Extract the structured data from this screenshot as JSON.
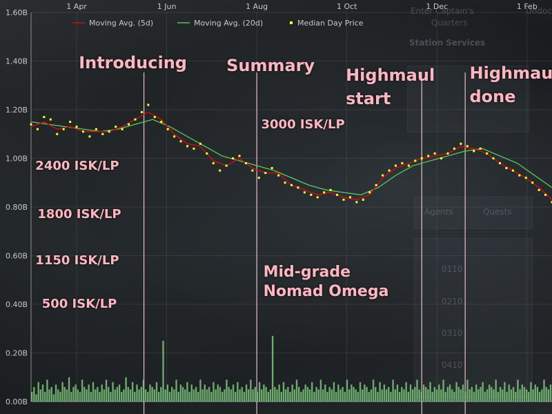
{
  "chart_data": {
    "type": "line",
    "title": "",
    "xlabel": "",
    "ylabel": "",
    "x_ticks": [
      "1 Apr",
      "1 Jun",
      "1 Aug",
      "1 Oct",
      "1 Dec",
      "1 Feb"
    ],
    "y_ticks": [
      "0.00B",
      "0.20B",
      "0.40B",
      "0.60B",
      "0.80B",
      "1.00B",
      "1.20B",
      "1.40B",
      "1.60B"
    ],
    "ylim": [
      0,
      1.6
    ],
    "grid": true,
    "legend_position": "top",
    "legend": [
      "Moving Avg.  (5d)",
      "Moving Avg.  (20d)",
      "Median Day Price"
    ],
    "colors": {
      "ma5": "#cc1111",
      "ma20": "#59c159",
      "median": "#ffff33",
      "volume": "#7cc47c",
      "annotation": "#ffb6c1",
      "vline": "#ffd1d9"
    },
    "series": [
      {
        "name": "Median Day Price",
        "points": [
          [
            0,
            1.14
          ],
          [
            3,
            1.12
          ],
          [
            6,
            1.17
          ],
          [
            9,
            1.16
          ],
          [
            12,
            1.1
          ],
          [
            15,
            1.12
          ],
          [
            18,
            1.15
          ],
          [
            21,
            1.13
          ],
          [
            24,
            1.11
          ],
          [
            27,
            1.09
          ],
          [
            30,
            1.12
          ],
          [
            33,
            1.1
          ],
          [
            36,
            1.11
          ],
          [
            39,
            1.13
          ],
          [
            42,
            1.12
          ],
          [
            45,
            1.14
          ],
          [
            48,
            1.16
          ],
          [
            51,
            1.19
          ],
          [
            54,
            1.22
          ],
          [
            57,
            1.17
          ],
          [
            60,
            1.15
          ],
          [
            63,
            1.12
          ],
          [
            66,
            1.09
          ],
          [
            69,
            1.07
          ],
          [
            72,
            1.05
          ],
          [
            75,
            1.04
          ],
          [
            78,
            1.06
          ],
          [
            81,
            1.02
          ],
          [
            84,
            0.98
          ],
          [
            87,
            0.95
          ],
          [
            90,
            0.97
          ],
          [
            93,
            1.0
          ],
          [
            96,
            1.01
          ],
          [
            99,
            0.98
          ],
          [
            102,
            0.95
          ],
          [
            105,
            0.92
          ],
          [
            108,
            0.94
          ],
          [
            111,
            0.96
          ],
          [
            114,
            0.93
          ],
          [
            117,
            0.9
          ],
          [
            120,
            0.89
          ],
          [
            123,
            0.88
          ],
          [
            126,
            0.86
          ],
          [
            129,
            0.85
          ],
          [
            132,
            0.84
          ],
          [
            135,
            0.86
          ],
          [
            138,
            0.87
          ],
          [
            141,
            0.85
          ],
          [
            144,
            0.83
          ],
          [
            147,
            0.84
          ],
          [
            150,
            0.82
          ],
          [
            153,
            0.83
          ],
          [
            156,
            0.86
          ],
          [
            159,
            0.89
          ],
          [
            162,
            0.93
          ],
          [
            165,
            0.95
          ],
          [
            168,
            0.97
          ],
          [
            171,
            0.98
          ],
          [
            174,
            0.97
          ],
          [
            177,
            0.99
          ],
          [
            180,
            1.0
          ],
          [
            183,
            1.01
          ],
          [
            186,
            1.02
          ],
          [
            189,
            1.0
          ],
          [
            192,
            1.02
          ],
          [
            195,
            1.04
          ],
          [
            198,
            1.06
          ],
          [
            201,
            1.05
          ],
          [
            204,
            1.03
          ],
          [
            207,
            1.04
          ],
          [
            210,
            1.02
          ],
          [
            213,
            1.0
          ],
          [
            216,
            0.98
          ],
          [
            219,
            0.96
          ],
          [
            222,
            0.95
          ],
          [
            225,
            0.93
          ],
          [
            228,
            0.92
          ],
          [
            231,
            0.9
          ],
          [
            234,
            0.87
          ],
          [
            237,
            0.85
          ],
          [
            240,
            0.82
          ]
        ]
      },
      {
        "name": "Moving Avg.  (5d)",
        "points": [
          [
            0,
            1.13
          ],
          [
            6,
            1.15
          ],
          [
            12,
            1.12
          ],
          [
            18,
            1.13
          ],
          [
            24,
            1.11
          ],
          [
            30,
            1.11
          ],
          [
            36,
            1.11
          ],
          [
            42,
            1.13
          ],
          [
            48,
            1.16
          ],
          [
            54,
            1.19
          ],
          [
            60,
            1.16
          ],
          [
            66,
            1.1
          ],
          [
            72,
            1.06
          ],
          [
            78,
            1.05
          ],
          [
            84,
            0.99
          ],
          [
            90,
            0.97
          ],
          [
            96,
            1.0
          ],
          [
            102,
            0.96
          ],
          [
            108,
            0.94
          ],
          [
            114,
            0.94
          ],
          [
            120,
            0.89
          ],
          [
            126,
            0.87
          ],
          [
            132,
            0.85
          ],
          [
            138,
            0.86
          ],
          [
            144,
            0.84
          ],
          [
            150,
            0.83
          ],
          [
            156,
            0.85
          ],
          [
            162,
            0.92
          ],
          [
            168,
            0.96
          ],
          [
            174,
            0.98
          ],
          [
            180,
            1.0
          ],
          [
            186,
            1.01
          ],
          [
            192,
            1.02
          ],
          [
            198,
            1.05
          ],
          [
            204,
            1.04
          ],
          [
            210,
            1.02
          ],
          [
            216,
            0.98
          ],
          [
            222,
            0.95
          ],
          [
            228,
            0.92
          ],
          [
            234,
            0.88
          ],
          [
            240,
            0.83
          ]
        ]
      },
      {
        "name": "Moving Avg.  (20d)",
        "points": [
          [
            0,
            1.15
          ],
          [
            8,
            1.14
          ],
          [
            16,
            1.13
          ],
          [
            24,
            1.12
          ],
          [
            32,
            1.11
          ],
          [
            40,
            1.12
          ],
          [
            48,
            1.14
          ],
          [
            56,
            1.16
          ],
          [
            64,
            1.13
          ],
          [
            72,
            1.09
          ],
          [
            80,
            1.05
          ],
          [
            88,
            1.01
          ],
          [
            96,
            0.99
          ],
          [
            104,
            0.97
          ],
          [
            112,
            0.95
          ],
          [
            120,
            0.92
          ],
          [
            128,
            0.89
          ],
          [
            136,
            0.87
          ],
          [
            144,
            0.86
          ],
          [
            152,
            0.85
          ],
          [
            160,
            0.88
          ],
          [
            168,
            0.93
          ],
          [
            176,
            0.97
          ],
          [
            184,
            0.99
          ],
          [
            192,
            1.01
          ],
          [
            200,
            1.03
          ],
          [
            208,
            1.04
          ],
          [
            216,
            1.01
          ],
          [
            224,
            0.98
          ],
          [
            232,
            0.93
          ],
          [
            240,
            0.88
          ]
        ]
      },
      {
        "name": "Volume",
        "values": [
          0.04,
          0.06,
          0.03,
          0.08,
          0.05,
          0.07,
          0.04,
          0.09,
          0.05,
          0.06,
          0.03,
          0.07,
          0.05,
          0.04,
          0.08,
          0.06,
          0.05,
          0.1,
          0.04,
          0.06,
          0.07,
          0.05,
          0.04,
          0.09,
          0.06,
          0.05,
          0.07,
          0.04,
          0.08,
          0.05,
          0.06,
          0.04,
          0.07,
          0.05,
          0.09,
          0.06,
          0.04,
          0.08,
          0.05,
          0.06,
          0.07,
          0.04,
          0.05,
          0.1,
          0.06,
          0.05,
          0.08,
          0.04,
          0.07,
          0.05,
          0.06,
          0.09,
          0.05,
          0.04,
          0.07,
          0.06,
          0.05,
          0.08,
          0.04,
          0.06,
          0.25,
          0.05,
          0.07,
          0.04,
          0.06,
          0.05,
          0.09,
          0.04,
          0.07,
          0.06,
          0.05,
          0.08,
          0.04,
          0.07,
          0.05,
          0.06,
          0.04,
          0.09,
          0.05,
          0.07,
          0.05,
          0.06,
          0.04,
          0.08,
          0.05,
          0.07,
          0.06,
          0.04,
          0.05,
          0.09,
          0.06,
          0.05,
          0.07,
          0.04,
          0.08,
          0.05,
          0.06,
          0.04,
          0.07,
          0.05,
          0.09,
          0.05,
          0.06,
          0.04,
          0.08,
          0.05,
          0.07,
          0.06,
          0.04,
          0.05,
          0.27,
          0.06,
          0.05,
          0.07,
          0.04,
          0.08,
          0.05,
          0.06,
          0.04,
          0.07,
          0.05,
          0.09,
          0.06,
          0.04,
          0.05,
          0.07,
          0.06,
          0.05,
          0.08,
          0.04,
          0.06,
          0.05,
          0.09,
          0.05,
          0.07,
          0.04,
          0.06,
          0.05,
          0.08,
          0.04,
          0.07,
          0.05,
          0.06,
          0.04,
          0.09,
          0.05,
          0.07,
          0.06,
          0.05,
          0.04,
          0.08,
          0.05,
          0.07,
          0.06,
          0.04,
          0.05,
          0.09,
          0.06,
          0.04,
          0.08,
          0.05,
          0.07,
          0.05,
          0.06,
          0.04,
          0.09,
          0.05,
          0.07,
          0.04,
          0.06,
          0.05,
          0.08,
          0.04,
          0.07,
          0.05,
          0.06,
          0.09,
          0.05,
          0.04,
          0.07,
          0.06,
          0.05,
          0.08,
          0.04,
          0.06,
          0.05,
          0.07,
          0.05,
          0.09,
          0.04,
          0.06,
          0.07,
          0.05,
          0.04,
          0.08,
          0.06,
          0.05,
          0.07,
          0.04,
          0.09,
          0.05,
          0.06,
          0.04,
          0.07,
          0.05,
          0.06,
          0.08,
          0.04,
          0.05,
          0.07,
          0.06,
          0.05,
          0.09,
          0.04,
          0.06,
          0.05,
          0.08,
          0.04,
          0.07,
          0.05,
          0.06,
          0.04,
          0.09,
          0.05,
          0.07,
          0.06,
          0.05,
          0.04,
          0.08,
          0.05,
          0.07,
          0.06,
          0.04,
          0.05,
          0.09,
          0.06,
          0.05,
          0.07
        ]
      }
    ],
    "event_lines": [
      {
        "x": 52
      },
      {
        "x": 104
      },
      {
        "x": 180
      },
      {
        "x": 200
      }
    ],
    "annotations": [
      {
        "text": "Introducing",
        "x": 22,
        "y": 1.44,
        "size": "big"
      },
      {
        "text": "Summary",
        "x": 90,
        "y": 1.43,
        "size": "big"
      },
      {
        "text": "Highmaul\nstart",
        "x": 145,
        "y": 1.39,
        "size": "big"
      },
      {
        "text": "Highmaul\ndone",
        "x": 202,
        "y": 1.4,
        "size": "big"
      },
      {
        "text": "3000 ISK/LP",
        "x": 106,
        "y": 1.17,
        "size": "small"
      },
      {
        "text": "2400 ISK/LP",
        "x": 2,
        "y": 1.0,
        "size": "small"
      },
      {
        "text": "1800 ISK/LP",
        "x": 3,
        "y": 0.8,
        "size": "small"
      },
      {
        "text": "1150 ISK/LP",
        "x": 2,
        "y": 0.61,
        "size": "small"
      },
      {
        "text": "500 ISK/LP",
        "x": 5,
        "y": 0.43,
        "size": "small"
      },
      {
        "text": "Mid-grade\nNomad Omega",
        "x": 107,
        "y": 0.57,
        "size": "mid"
      }
    ]
  },
  "background": {
    "ghost_text": [
      "Enter Captain's",
      "Quarters",
      "Undock",
      "Station Services",
      "Agents",
      "Quests",
      "0110",
      "0210",
      "0310",
      "0410"
    ]
  }
}
